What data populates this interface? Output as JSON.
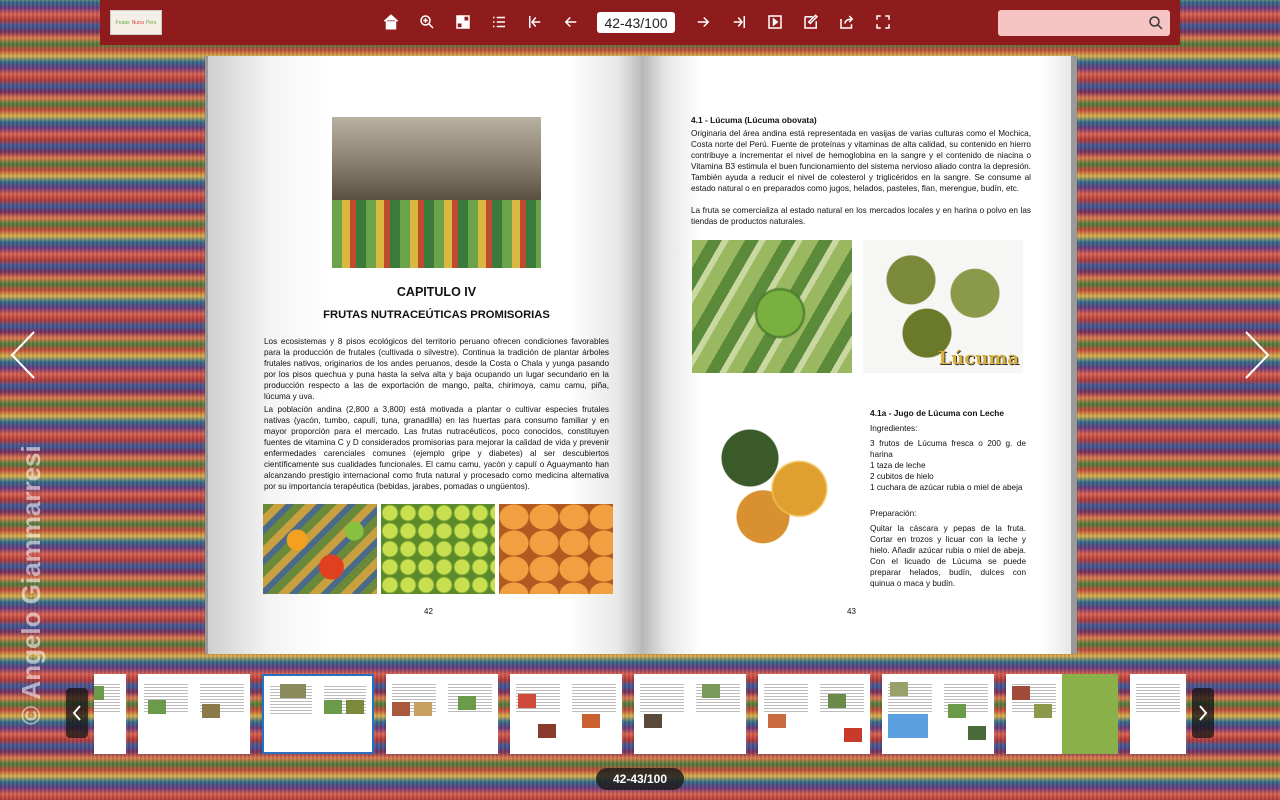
{
  "toolbar": {
    "logo_parts": [
      "Frutas",
      "Nutra",
      "Peru"
    ],
    "page_indicator": "42-43/100",
    "search_placeholder": "",
    "buttons": [
      "home-icon",
      "zoom-in-icon",
      "thumbnails-icon",
      "table-of-contents-icon",
      "first-page-icon",
      "previous-page-icon",
      "next-page-icon",
      "last-page-icon",
      "autoplay-icon",
      "notes-icon",
      "share-icon",
      "fullscreen-icon"
    ]
  },
  "left_page": {
    "chapter": "CAPITULO IV",
    "subtitle": "FRUTAS NUTRACEÚTICAS PROMISORIAS",
    "para1": "Los ecosistemas y 8 pisos ecológicos del territorio peruano ofrecen condiciones favorables para la producción de frutales (cultivada o silvestre). Continua la tradición de plantar árboles frutales nativos, originarios de los andes peruanos, desde la Costa o Chala y yunga pasando por los pisos quechua y puna hasta la selva alta y baja ocupando un lugar secundario en la producción respecto a las de exportación de mango, palta, chirimoya, camu camu, piña, lúcuma y uva.",
    "para2": "La población andina (2,800 a 3,800) está motivada a plantar o cultivar especies frutales nativas (yacón, tumbo, capulí, tuna, granadilla) en las huertas para consumo familiar y en mayor proporción para el mercado. Las frutas nutracéuticos, poco conocidos, constituyen fuentes de vitamina C y D considerados promisorias para mejorar la calidad de vida y prevenir enfermedades carenciales comunes (ejemplo gripe y diabetes) al ser descubiertos científicamente sus cualidades funcionales. El camu camu, yacón y capulí o Aguaymanto han alcanzando prestigio internacional como fruta natural y procesado como medicina alternativa por su importancia terapéutica (bebidas, jarabes, pomadas o ungüentos).",
    "page_number": "42"
  },
  "right_page": {
    "heading": "4.1 - Lúcuma (Lúcuma obovata)",
    "para1": "Originaria del área andina está representada en vasijas de varias culturas como el Mochica, Costa norte del Perú. Fuente de proteínas y vitaminas de alta calidad, su contenido en hierro contribuye a incrementar el nivel de hemoglobina en la sangre y el contenido de niacina o Vitamina B3 estimula el buen funcionamiento del sistema nervioso aliado contra la depresión. También ayuda a reducir el nivel de colesterol y triglicéridos en la sangre. Se consume al estado natural o en preparados como jugos, helados, pasteles, flan, merengue, budín, etc.",
    "para2": "La fruta se comercializa al estado natural en los mercados locales y en harina o polvo en las tiendas de productos naturales.",
    "photo_label": "Lúcuma",
    "recipe_title": "4.1a - Jugo de Lúcuma con Leche",
    "ingredients_label": "Ingredientes:",
    "ingredients": "3 frutos de Lúcuma fresca o 200 g. de harina\n1 taza de leche\n2 cubitos de hielo\n1 cuchara de azúcar rubia o miel de abeja",
    "preparation_label": "Preparación:",
    "preparation": "Quitar la cáscara y pepas de la fruta. Cortar en trozos y licuar con la leche y hielo. Añadir azúcar rubia o miel de abeja. Con el licuado de Lúcuma se puede preparar helados, budín, dulces con quinua o maca y budín.",
    "page_number": "43"
  },
  "watermark": "© Angelo Giammarresi",
  "bottom_counter": "42-43/100",
  "colors": {
    "toolbar": "#8f1c1c",
    "search": "#f7c4c4",
    "active_thumb": "#2a70c0"
  }
}
